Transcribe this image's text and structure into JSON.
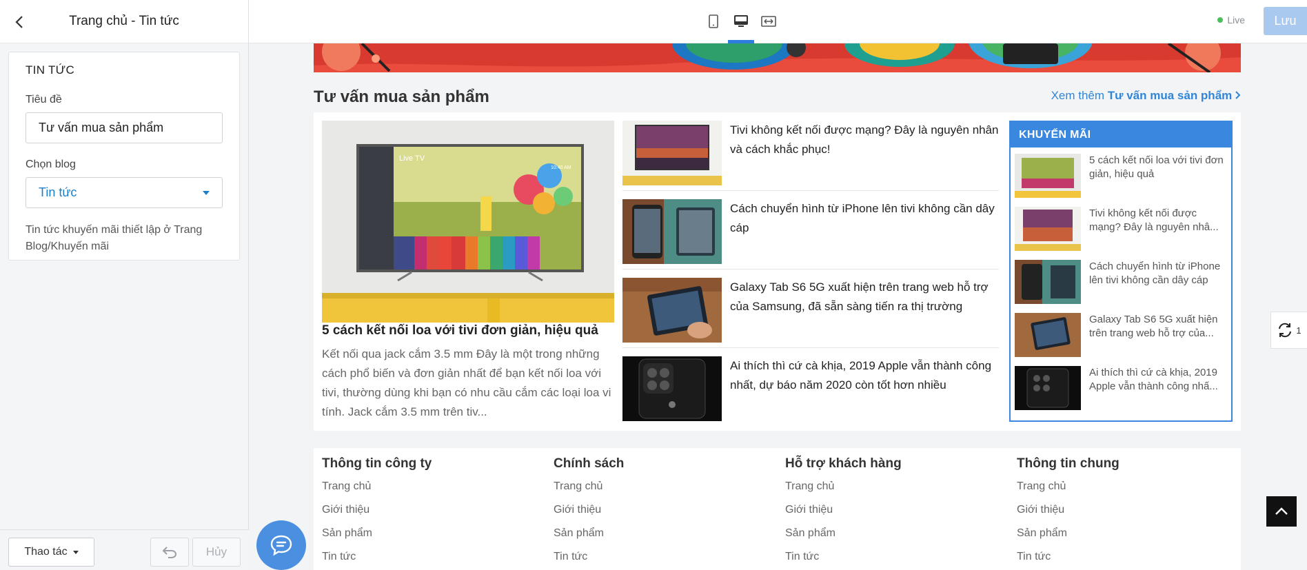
{
  "sidebar": {
    "title": "Trang chủ - Tin tức",
    "card_title": "TIN TỨC",
    "title_label": "Tiêu đề",
    "title_value": "Tư vấn mua sản phẩm",
    "blog_label": "Chọn blog",
    "blog_value": "Tin tức",
    "note": "Tin tức khuyến mãi thiết lập ở Trang Blog/Khuyến mãi",
    "actions_label": "Thao tác",
    "cancel_label": "Hủy"
  },
  "topbar": {
    "devices": [
      "mobile-icon",
      "desktop-icon",
      "fullwidth-icon"
    ],
    "active_device": "desktop",
    "live_label": "Live",
    "save_label": "Lưu"
  },
  "preview": {
    "section_title": "Tư vấn mua sản phẩm",
    "view_more_prefix": "Xem thêm",
    "view_more_target": "Tư vấn mua sản phẩm",
    "featured": {
      "title": "5 cách kết nối loa với tivi đơn giản, hiệu quả",
      "desc": "Kết nối qua jack cắm 3.5 mm Đây là một trong những cách phổ biến và đơn giản nhất để bạn kết nối loa với tivi, thường dùng khi bạn có nhu cầu cắm các loại loa vi tính. Jack cắm 3.5 mm trên tiv...",
      "screen_label": "Live TV",
      "screen_time": "10:40 AM"
    },
    "news": [
      {
        "title": "Tivi không kết nối được mạng? Đây là nguyên nhân và cách khắc phục!"
      },
      {
        "title": "Cách chuyển hình từ iPhone lên tivi không cần dây cáp"
      },
      {
        "title": "Galaxy Tab S6 5G xuất hiện trên trang web hỗ trợ của Samsung, đã sẵn sàng tiến ra thị trường"
      },
      {
        "title": "Ai thích thì cứ cà khịa, 2019 Apple vẫn thành công nhất, dự báo năm 2020 còn tốt hơn nhiều"
      }
    ],
    "promo": {
      "header": "KHUYẾN MÃI",
      "items": [
        {
          "title": "5 cách kết nối loa với tivi đơn giản, hiệu quả"
        },
        {
          "title": "Tivi không kết nối được mạng? Đây là nguyên nhâ..."
        },
        {
          "title": "Cách chuyển hình từ iPhone lên tivi không cần dây cáp"
        },
        {
          "title": "Galaxy Tab S6 5G xuất hiện trên trang web hỗ trợ của..."
        },
        {
          "title": "Ai thích thì cứ cà khịa, 2019 Apple vẫn thành công nhấ..."
        }
      ]
    },
    "footer_columns": [
      {
        "title": "Thông tin công ty",
        "links": [
          "Trang chủ",
          "Giới thiệu",
          "Sản phẩm",
          "Tin tức"
        ]
      },
      {
        "title": "Chính sách",
        "links": [
          "Trang chủ",
          "Giới thiệu",
          "Sản phẩm",
          "Tin tức"
        ]
      },
      {
        "title": "Hỗ trợ khách hàng",
        "links": [
          "Trang chủ",
          "Giới thiệu",
          "Sản phẩm",
          "Tin tức"
        ]
      },
      {
        "title": "Thông tin chung",
        "links": [
          "Trang chủ",
          "Giới thiệu",
          "Sản phẩm",
          "Tin tức"
        ]
      }
    ],
    "sync_count": "1"
  },
  "colors": {
    "accent": "#3a87df",
    "link": "#2f86d8",
    "save_button": "#a9c9ef",
    "live_dot": "#4bbf5a"
  }
}
